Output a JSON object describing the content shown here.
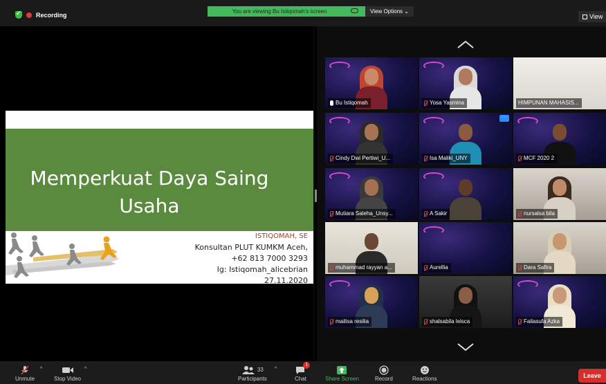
{
  "topbar": {
    "recording_label": "Recording",
    "viewing_banner": "You are viewing Bu Istiqomah's screen",
    "view_options_label": "View Options ⌄",
    "view_button_label": "View"
  },
  "slide": {
    "title_line1": "Memperkuat Daya Saing",
    "title_line2": "Usaha",
    "presenter_name": "ISTIQOMAH, SE",
    "presenter_role": "Konsultan PLUT KUMKM Aceh,",
    "phone": "+62 813 7000 3293",
    "instagram": "Ig: Istiqomah_alicebrian",
    "date": "27.11.2020",
    "accent_green": "#5a8a3e"
  },
  "gallery": {
    "participants": [
      {
        "name": "Bu Istiqomah",
        "muted": false,
        "active": true
      },
      {
        "name": "Yosa Yasmina",
        "muted": true
      },
      {
        "name": "HIMPUNAN MAHASIS...",
        "muted": false
      },
      {
        "name": "Cindy Dwi Pertiwi_U...",
        "muted": true
      },
      {
        "name": "Isa Maliki_UNY",
        "muted": true
      },
      {
        "name": "MCF 2020 2",
        "muted": true
      },
      {
        "name": "Mutiara Saleha_Unsy...",
        "muted": true
      },
      {
        "name": "A Sakir",
        "muted": true
      },
      {
        "name": "nursalsa bila",
        "muted": true
      },
      {
        "name": "muhammad rayyan a...",
        "muted": true
      },
      {
        "name": "Aurellia",
        "muted": true
      },
      {
        "name": "Dara Safira",
        "muted": true
      },
      {
        "name": "mailisa resilia",
        "muted": true
      },
      {
        "name": "shalsabila leisca",
        "muted": true
      },
      {
        "name": "Failasufa Azka",
        "muted": true
      }
    ],
    "more_label": "···"
  },
  "toolbar": {
    "unmute": "Unmute",
    "stop_video": "Stop Video",
    "participants": "Participants",
    "participants_count": "33",
    "chat": "Chat",
    "chat_badge": "1",
    "share_screen": "Share Screen",
    "record": "Record",
    "reactions": "Reactions",
    "leave": "Leave",
    "share_color": "#43b85d",
    "leave_color": "#d32f2f"
  }
}
